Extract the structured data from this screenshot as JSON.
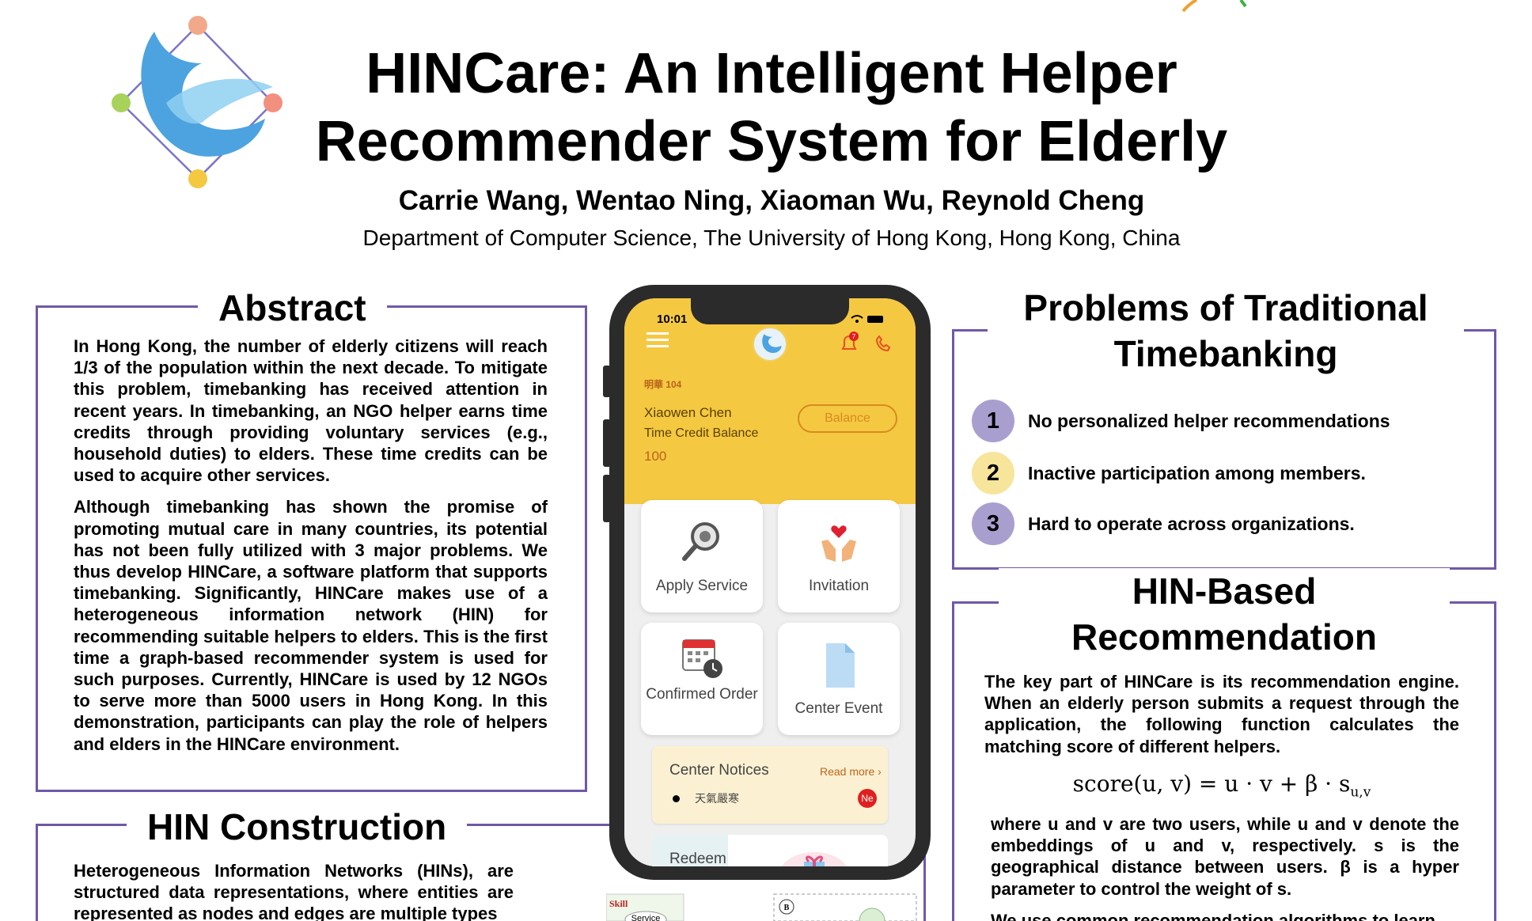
{
  "header": {
    "title": "HINCare: An Intelligent Helper Recommender System for Elderly",
    "authors": "Carrie Wang, Wentao Ning, Xiaoman Wu, Reynold Cheng",
    "affiliation": "Department of Computer Science, The University of Hong Kong, Hong Kong, China"
  },
  "abstract": {
    "title": "Abstract",
    "p1": "In Hong Kong, the number of elderly citizens will reach 1/3 of the population within the next decade. To mitigate this problem, timebanking has received attention in recent years. In timebanking, an NGO helper earns time credits through providing voluntary services (e.g., household duties) to elders. These time credits can be used to acquire other services.",
    "p2": "Although timebanking has shown the promise of promoting mutual care in many countries, its potential has not been fully utilized with 3 major problems. We thus develop HINCare, a software platform that supports timebanking. Significantly, HINCare makes use of a heterogeneous information network (HIN) for recommending suitable helpers to elders. This is the first time a graph-based recommender system is used for such purposes. Currently, HINCare is used by 12 NGOs to serve more than 5000 users in Hong Kong. In this demonstration, participants can play the role of helpers and elders in the HINCare environment."
  },
  "hin_construction": {
    "title": "HIN Construction",
    "text": "Heterogeneous Information Networks (HINs), are structured data representations, where entities are represented as nodes and edges are multiple types"
  },
  "problems": {
    "title": "Problems of Traditional Timebanking",
    "items": [
      {
        "num": "1",
        "text": "No personalized helper recommendations",
        "color": "#a99fcf"
      },
      {
        "num": "2",
        "text": "Inactive participation among members.",
        "color": "#f7e59c"
      },
      {
        "num": "3",
        "text": "Hard to operate across organizations.",
        "color": "#a99fcf"
      }
    ]
  },
  "recommendation": {
    "title": "HIN-Based Recommendation",
    "text1": "The key part of HINCare is its recommendation engine. When an elderly person submits a request through the application, the following function calculates the matching score of different helpers.",
    "formula": "score(u, v) = u · v + β · s",
    "formula_sub": "u,v",
    "text2": "where u and v are two users, while u and v denote the embeddings of u and v, respectively. s is the geographical distance between users. β is a hyper parameter to control the weight of s.",
    "text3": "We use common recommendation algorithms to learn"
  },
  "phone": {
    "clock": "10:01",
    "bell_count": "7",
    "org": "明華 104",
    "user_name": "Xiaowen Chen",
    "credit_label": "Time Credit Balance",
    "credit_value": "100",
    "balance_button": "Balance",
    "tiles": {
      "apply": "Apply Service",
      "invitation": "Invitation",
      "confirmed": "Confirmed Order",
      "center_event": "Center Event"
    },
    "notices": {
      "title": "Center Notices",
      "read_more": "Read more ›",
      "item": "天氣嚴寒",
      "badge": "Ne"
    },
    "redeem": "Redeem"
  },
  "fragment": {
    "skill": "Skill",
    "service": "Service",
    "b": "B"
  },
  "colors": {
    "accent_border": "#6f59a8",
    "app_yellow": "#f5c842",
    "badge_purple": "#a99fcf",
    "badge_yellow": "#f7e59c"
  }
}
